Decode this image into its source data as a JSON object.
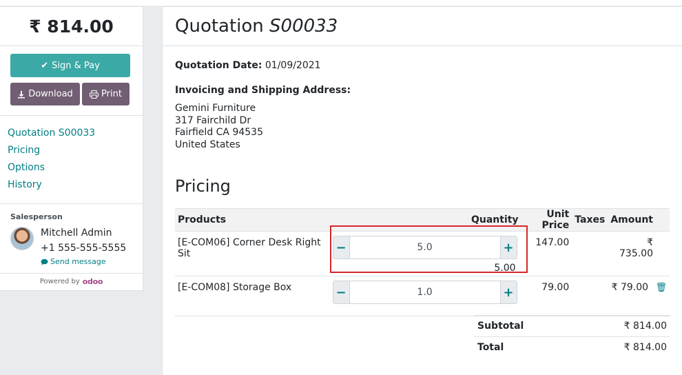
{
  "sidebar": {
    "amount": "₹ 814.00",
    "sign_pay_label": "Sign & Pay",
    "download_label": "Download",
    "print_label": "Print",
    "nav": [
      {
        "label": "Quotation S00033"
      },
      {
        "label": "Pricing"
      },
      {
        "label": "Options"
      },
      {
        "label": "History"
      }
    ],
    "salesperson": {
      "title": "Salesperson",
      "name": "Mitchell Admin",
      "phone": "+1 555-555-5555",
      "message_label": "Send message"
    },
    "powered_by": "Powered by",
    "brand": "odoo"
  },
  "main": {
    "title_prefix": "Quotation",
    "title_ref": "S00033",
    "quotation_date_label": "Quotation Date:",
    "quotation_date": "01/09/2021",
    "address_label": "Invoicing and Shipping Address:",
    "address": {
      "name": "Gemini Furniture",
      "line1": "317 Fairchild Dr",
      "line2": "Fairfield CA 94535",
      "country": "United States"
    },
    "pricing_title": "Pricing",
    "table": {
      "headers": {
        "products": "Products",
        "quantity": "Quantity",
        "unit_price": "Unit Price",
        "taxes": "Taxes",
        "amount": "Amount"
      },
      "rows": [
        {
          "product": "[E-COM06] Corner Desk Right Sit",
          "qty_input": "5.0",
          "qty_display": "5.00",
          "unit_price": "147.00",
          "taxes": "",
          "amount": "₹ 735.00"
        },
        {
          "product": "[E-COM08] Storage Box",
          "qty_input": "1.0",
          "qty_display": "",
          "unit_price": "79.00",
          "taxes": "",
          "amount": "₹ 79.00"
        }
      ]
    },
    "totals": {
      "subtotal_label": "Subtotal",
      "subtotal": "₹ 814.00",
      "total_label": "Total",
      "total": "₹ 814.00"
    }
  },
  "colors": {
    "accent": "#017e84",
    "sign_button": "#3ba9a5",
    "secondary_button": "#715e73",
    "highlight": "#d62728"
  }
}
